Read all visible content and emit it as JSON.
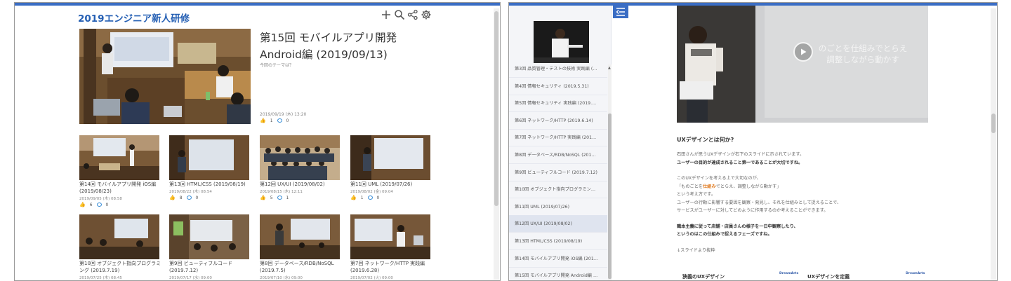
{
  "left": {
    "site_title": "2019エンジニア新人研修",
    "toolbar": [
      "plus-icon",
      "search-icon",
      "share-icon",
      "gear-icon"
    ],
    "feature": {
      "title_line1": "第15回 モバイルアプリ開発",
      "title_line2": "Android編 (2019/09/13)",
      "subtitle": "今回のテーマは？",
      "date": "2019/09/19 (木) 13:20",
      "likes": "1",
      "comments": "0"
    },
    "cards": [
      {
        "title": "第14回 モバイルアプリ開発 iOS編 (2019/08/23)",
        "date": "2019/09/05 (木) 08:58",
        "likes": "6",
        "comments": "0"
      },
      {
        "title": "第13回 HTML/CSS (2019/08/19)",
        "date": "2019/08/22 (木) 08:54",
        "likes": "8",
        "comments": "0"
      },
      {
        "title": "第12回 UX/UI (2019/08/02)",
        "date": "2019/08/15 (木) 12:11",
        "likes": "5",
        "comments": "1"
      },
      {
        "title": "第11回 UML (2019/07/26)",
        "date": "2019/08/02 (金) 09:04",
        "likes": "1",
        "comments": "0"
      },
      {
        "title": "第10回 オブジェクト指向プログラミング (2019.7.19)",
        "date": "2019/07/25 (木) 08:45",
        "likes": "",
        "comments": ""
      },
      {
        "title": "第9回 ビューティフルコード (2019.7.12)",
        "date": "2019/07/17 (水) 09:00",
        "likes": "",
        "comments": ""
      },
      {
        "title": "第8回 データベース/RDB/NoSQL (2019.7.5)",
        "date": "2019/07/10 (水) 09:00",
        "likes": "",
        "comments": ""
      },
      {
        "title": "第7回 ネットワーク/HTTP 実践編 (2019.6.28)",
        "date": "2019/07/02 (火) 09:00",
        "likes": "",
        "comments": ""
      }
    ]
  },
  "right": {
    "sidebar": {
      "items": [
        "第3回 品質管理・テストの技術 実践編 (…",
        "第4回 情報セキュリティ (2019.5.31)",
        "第5回 情報セキュリティ 実践編 (2019.…",
        "第6回 ネットワーク/HTTP (2019.6.14)",
        "第7回 ネットワーク/HTTP 実践編 (201…",
        "第8回 データベース/RDB/NoSQL (201…",
        "第9回 ビューティフルコード (2019.7.12)",
        "第10回 オブジェクト指向プログラミン…",
        "第11回 UML (2019/07/26)",
        "第12回 UX/UI (2019/08/02)",
        "第13回 HTML/CSS (2019/08/19)",
        "第14回 モバイルアプリ開発 iOS編 (201…",
        "第15回 モバイルアプリ開発 Android編 …"
      ],
      "active_index": 9
    },
    "video": {
      "caption_line1": "のごとを仕組みでとらえ",
      "caption_line2": "調整しながら動かす"
    },
    "article": {
      "heading": "UXデザインとは何か?",
      "p1": "石田さんが思うUXデザインが右下のスライドに示されています。",
      "p1_bold": "ユーザーの目的が達成されること第一であることが大切ですね。",
      "p2_1": "このUXデザインを考える上で大切なのが、",
      "p2_2_pre": "「ものごとを",
      "p2_2_hl": "仕組み",
      "p2_2_post": "でとらえ、調整しながら動かす」",
      "p2_3": "という考え方です。",
      "p2_4": "ユーザーの行動に影響する要因を観察・発見し、それを仕組みとして捉えることで、",
      "p2_5": "サービスがユーザーに対してどのように作用するのか考えることができます。",
      "p3_1": "職本主義に従って店舗・店員さんの様子を一日中観察したり、",
      "p3_2": "というのはこの仕組みで捉えるフェーズですね。",
      "p4": "↓スライドより抜粋",
      "slide_left": "狭義のUXデザイン",
      "slide_right": "UXデザインを定義",
      "slide_logo": "DreamArts"
    }
  }
}
